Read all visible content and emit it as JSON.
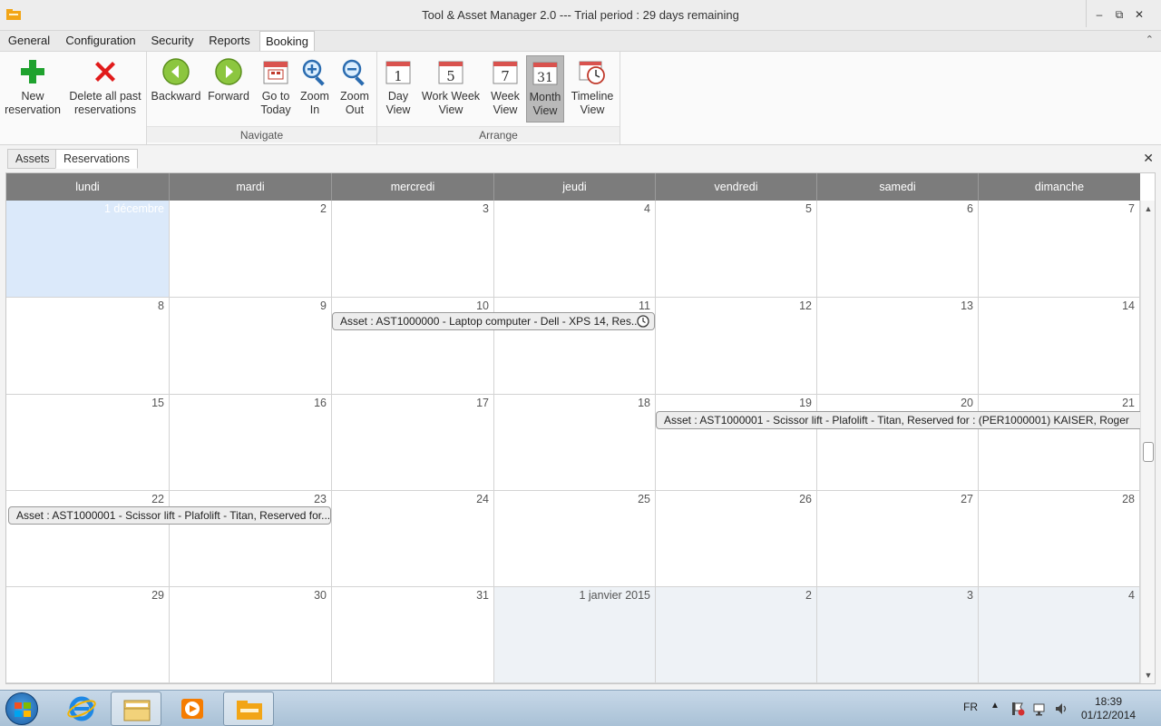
{
  "window": {
    "title": "Tool & Asset Manager 2.0 --- Trial period : 29 days remaining",
    "controls": {
      "minimize": "–",
      "restore": "⧉",
      "close": "✕"
    }
  },
  "menu": {
    "items": [
      "General",
      "Configuration",
      "Security",
      "Reports",
      "Booking"
    ],
    "active": "Booking",
    "collapse_glyph": "⌃"
  },
  "ribbon": {
    "buttons": {
      "new": "New\nreservation",
      "delete_past": "Delete all past\nreservations",
      "backward": "Backward",
      "forward": "Forward",
      "today": "Go to\nToday",
      "zoom_in": "Zoom\nIn",
      "zoom_out": "Zoom\nOut",
      "day": "Day\nView",
      "work_week": "Work Week\nView",
      "week": "Week\nView",
      "month": "Month\nView",
      "timeline": "Timeline\nView"
    },
    "icon_numbers": {
      "day": "1",
      "work_week": "5",
      "week": "7",
      "month": "31"
    },
    "groups": {
      "navigate": "Navigate",
      "arrange": "Arrange"
    },
    "selected_view": "month"
  },
  "doc_tabs": {
    "assets": "Assets",
    "reservations": "Reservations",
    "active": "Reservations",
    "close_glyph": "✕"
  },
  "calendar": {
    "day_names": [
      "lundi",
      "mardi",
      "mercredi",
      "jeudi",
      "vendredi",
      "samedi",
      "dimanche"
    ],
    "weeks": [
      [
        "1 décembre",
        "2",
        "3",
        "4",
        "5",
        "6",
        "7"
      ],
      [
        "8",
        "9",
        "10",
        "11",
        "12",
        "13",
        "14"
      ],
      [
        "15",
        "16",
        "17",
        "18",
        "19",
        "20",
        "21"
      ],
      [
        "22",
        "23",
        "24",
        "25",
        "26",
        "27",
        "28"
      ],
      [
        "29",
        "30",
        "31",
        "1 janvier 2015",
        "2",
        "3",
        "4"
      ]
    ],
    "events": [
      {
        "text": "Asset : AST1000000 - Laptop computer - Dell - XPS 14, Res...",
        "has_clock": true
      },
      {
        "text": "Asset : AST1000001 - Scissor lift - Plafolift - Titan, Reserved for : (PER1000001) KAISER, Roger",
        "has_clock": false
      },
      {
        "text": "Asset : AST1000001 - Scissor lift - Plafolift - Titan, Reserved for...",
        "has_clock": false
      }
    ]
  },
  "taskbar": {
    "language": "FR",
    "time": "18:39",
    "date": "01/12/2014"
  }
}
